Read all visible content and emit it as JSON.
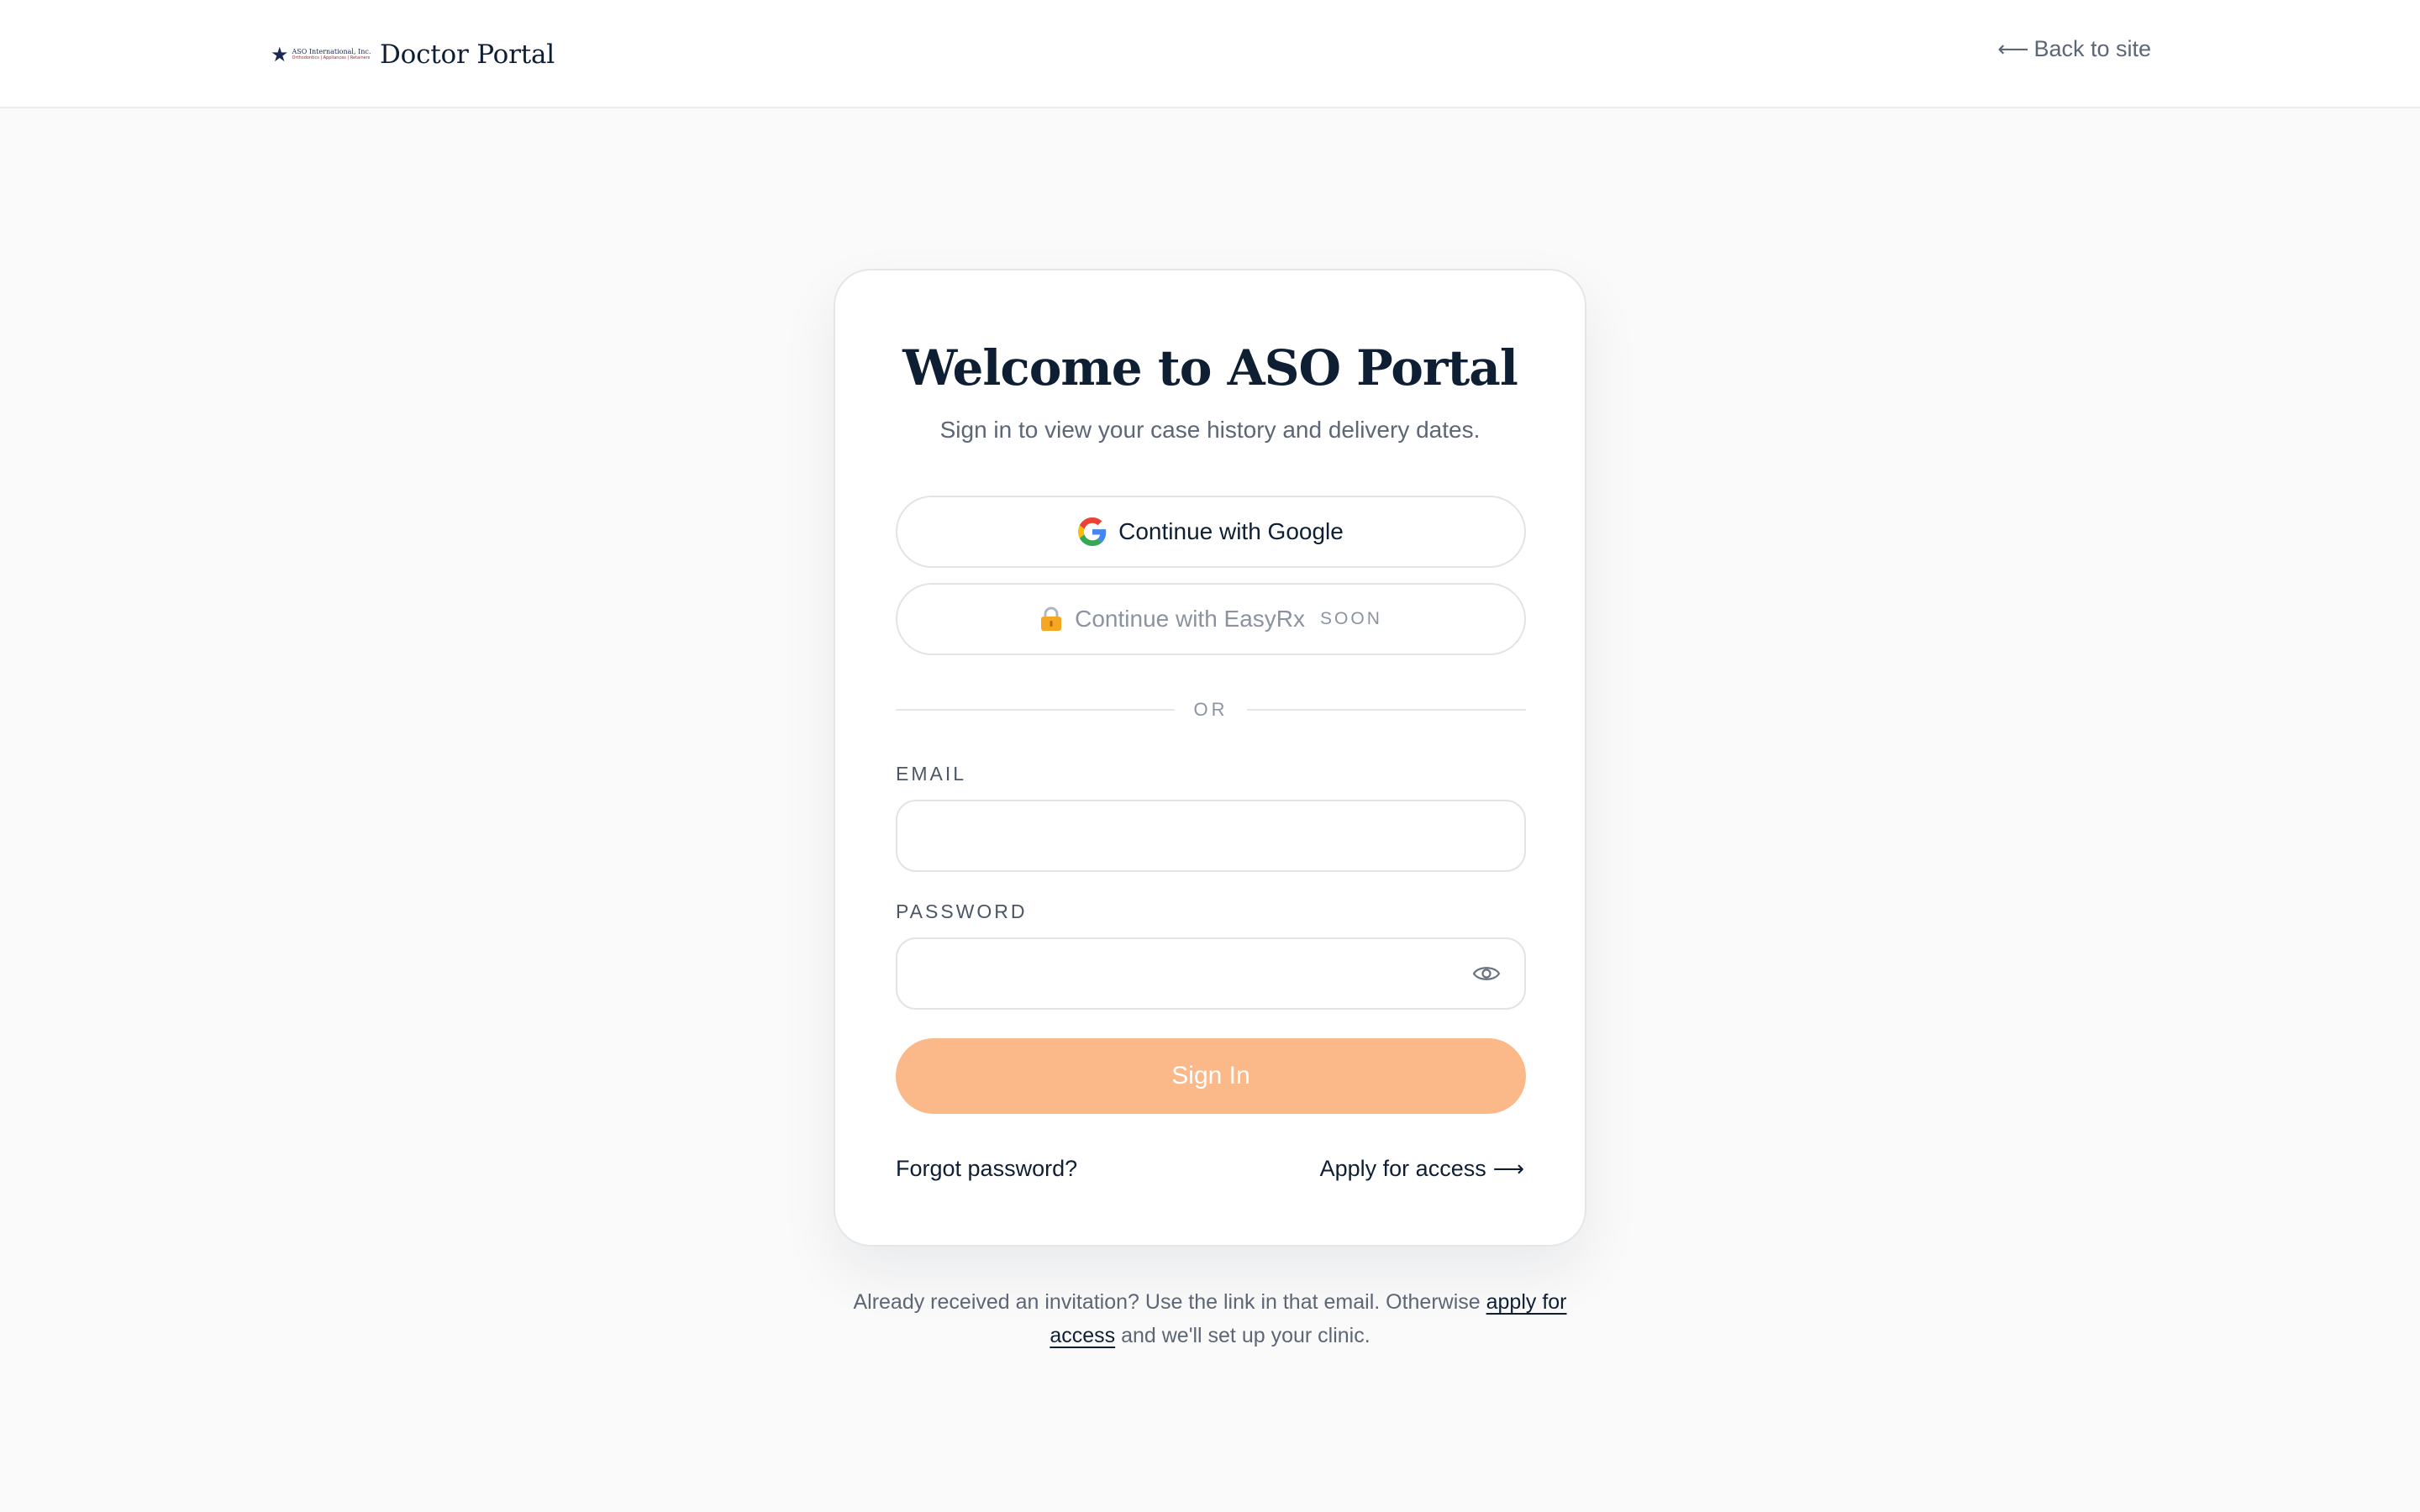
{
  "header": {
    "logo_line1": "ASO International, Inc.",
    "logo_line2": "Orthodontics | Appliances | Retainers",
    "title": "Doctor Portal",
    "back_link": "Back to site",
    "back_icon": "arrow-left-icon"
  },
  "card": {
    "title": "Welcome to ASO Portal",
    "subtitle": "Sign in to view your case history and delivery dates.",
    "google_button": "Continue with Google",
    "easyrx_button": "Continue with EasyRx",
    "easyrx_badge": "SOON",
    "divider": "OR",
    "email_label": "EMAIL",
    "email_value": "",
    "email_placeholder": "",
    "password_label": "PASSWORD",
    "password_value": "",
    "password_placeholder": "",
    "signin_button": "Sign In",
    "forgot_link": "Forgot password?",
    "apply_link": "Apply for access"
  },
  "footer": {
    "text_before": "Already received an invitation? Use the link in that email. Otherwise ",
    "link": "apply for access",
    "text_after": " and we'll set up your clinic."
  },
  "colors": {
    "accent": "#fbb98a",
    "text_dark": "#0f1f33",
    "text_muted": "#5c6675",
    "page_bg": "#fafafa",
    "card_bg": "#ffffff"
  }
}
